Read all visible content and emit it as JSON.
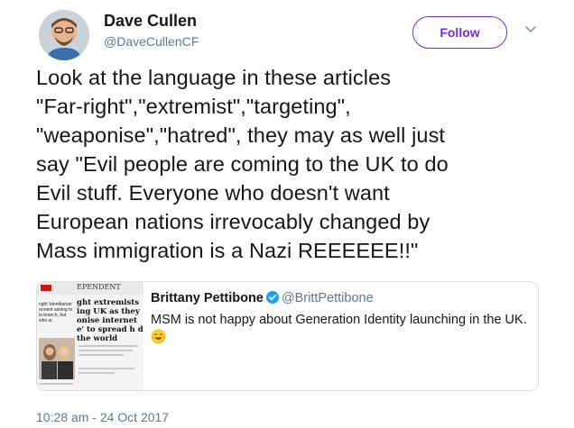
{
  "header": {
    "name": "Dave Cullen",
    "handle": "@DaveCullenCF",
    "follow_label": "Follow"
  },
  "tweet": {
    "text": "Look at the language in these articles\n\"Far-right\",\"extremist\",\"targeting\",\n\"weaponise\",\"hatred\", they may as well just\nsay \"Evil people are coming to the UK to do\nEvil stuff. Everyone who doesn't want\nEuropean nations irrevocably changed by\nMass immigration is a Nazi REEEEEE!!\"",
    "timestamp": "10:28 am - 24 Oct 2017"
  },
  "quote": {
    "name": "Brittany Pettibone",
    "handle": "@BrittPettibone",
    "text": "MSM is not happy about Generation Identity launching in the UK.",
    "thumb": {
      "paper_title": "EPENDENT",
      "headline_left": "right 'identitarian' rement aiming to la branch, but who ar",
      "headline_right": "ght extremists ing UK as they onise internet e' to spread h d the world"
    }
  },
  "colors": {
    "accent": "#7b2bd6",
    "text": "#14171a",
    "muted": "#657786",
    "verified": "#1da1f2"
  },
  "icons": {
    "caret": "chevron-down-icon",
    "verified": "verified-badge-icon",
    "emoji": "face-with-tears-of-joy-icon"
  }
}
